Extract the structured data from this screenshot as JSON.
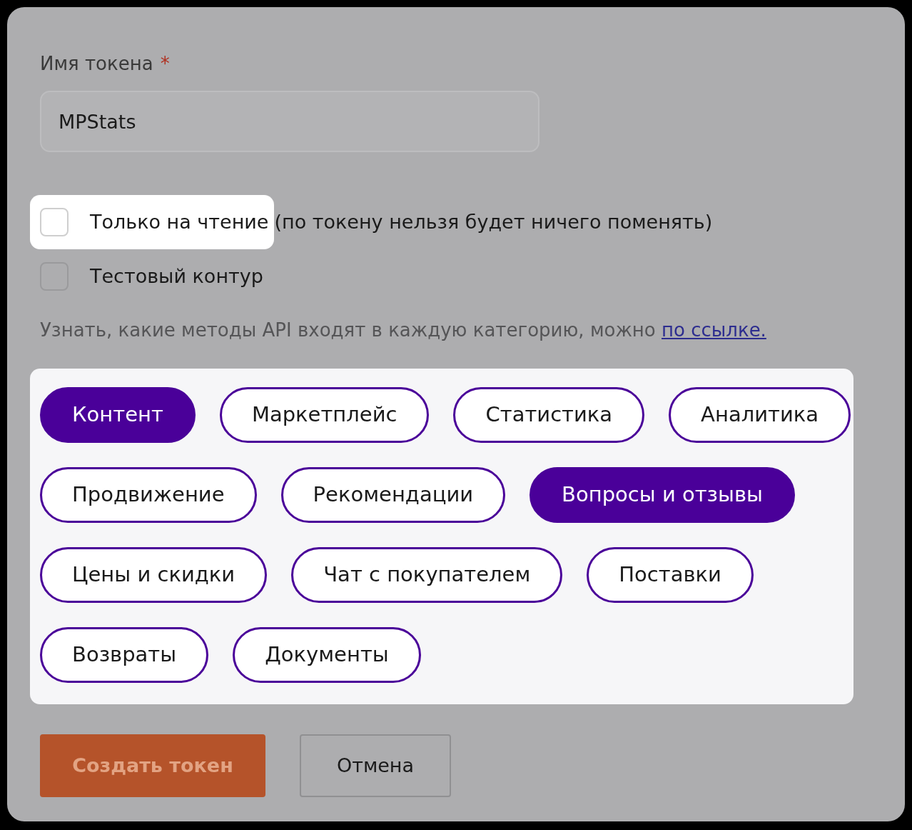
{
  "token_name": {
    "label": "Имя токена",
    "required_mark": "*",
    "value": "MPStats"
  },
  "options": [
    {
      "label": "Только на чтение",
      "note": "(по токену нельзя будет ничего поменять)",
      "checked": false,
      "highlighted": true
    },
    {
      "label": "Тестовый контур",
      "checked": false,
      "highlighted": false
    }
  ],
  "hint": {
    "text": "Узнать, какие методы API входят в каждую категорию, можно",
    "link": "по ссылке."
  },
  "categories": {
    "highlighted": true,
    "rows": [
      [
        {
          "label": "Контент",
          "selected": true
        },
        {
          "label": "Маркетплейс",
          "selected": false
        },
        {
          "label": "Статистика",
          "selected": false
        },
        {
          "label": "Аналитика",
          "selected": false
        }
      ],
      [
        {
          "label": "Продвижение",
          "selected": false
        },
        {
          "label": "Рекомендации",
          "selected": false
        },
        {
          "label": "Вопросы и отзывы",
          "selected": true
        }
      ],
      [
        {
          "label": "Цены и скидки",
          "selected": false
        },
        {
          "label": "Чат с покупателем",
          "selected": false
        },
        {
          "label": "Поставки",
          "selected": false
        }
      ],
      [
        {
          "label": "Возвраты",
          "selected": false
        },
        {
          "label": "Документы",
          "selected": false
        }
      ]
    ]
  },
  "buttons": {
    "create": "Создать токен",
    "cancel": "Отмена"
  }
}
